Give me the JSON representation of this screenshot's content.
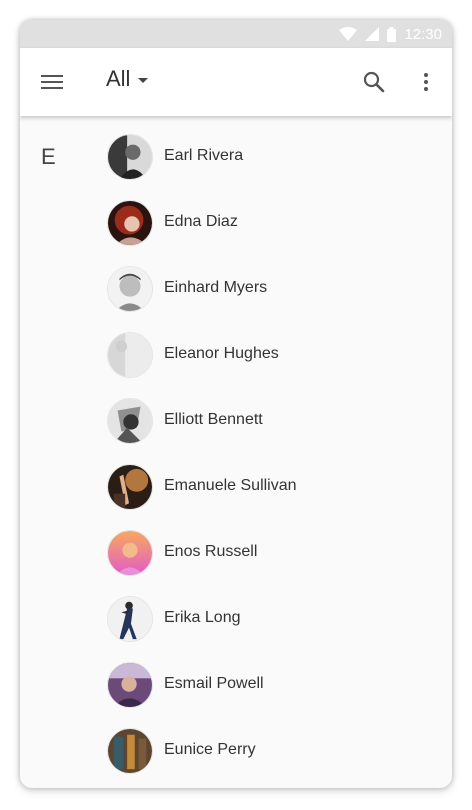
{
  "status_bar": {
    "time": "12:30"
  },
  "app_bar": {
    "menu_icon": "hamburger-menu-icon",
    "filter_label": "All",
    "search_icon": "search-icon",
    "more_icon": "more-vert-icon"
  },
  "section": {
    "letter": "E"
  },
  "contacts": [
    {
      "name": "Earl Rivera"
    },
    {
      "name": "Edna Diaz"
    },
    {
      "name": "Einhard Myers"
    },
    {
      "name": "Eleanor Hughes"
    },
    {
      "name": "Elliott Bennett"
    },
    {
      "name": "Emanuele Sullivan"
    },
    {
      "name": "Enos Russell"
    },
    {
      "name": "Erika Long"
    },
    {
      "name": "Esmail Powell"
    },
    {
      "name": "Eunice Perry"
    }
  ],
  "colors": {
    "status_bar_bg": "#e0e0e0",
    "app_bar_bg": "#ffffff",
    "list_bg": "#fafafa",
    "text_primary": "#333333"
  }
}
